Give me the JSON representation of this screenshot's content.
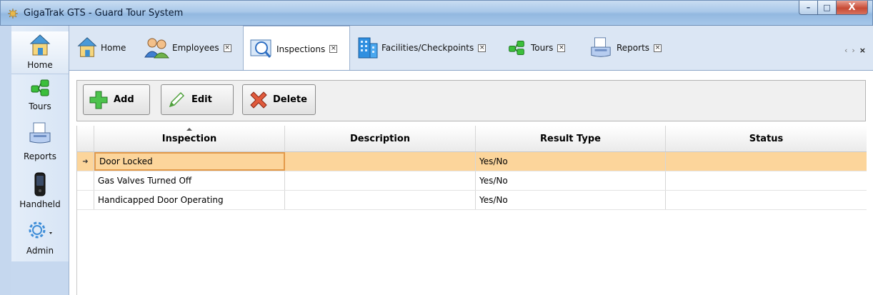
{
  "window": {
    "title": "GigaTrak GTS - Guard Tour System",
    "min_symbol": "–",
    "max_symbol": "□",
    "close_symbol": "X"
  },
  "leftnav": {
    "items": [
      {
        "label": "Home",
        "icon": "home-icon"
      },
      {
        "label": "Tours",
        "icon": "tours-icon"
      },
      {
        "label": "Reports",
        "icon": "reports-icon"
      },
      {
        "label": "Handheld",
        "icon": "handheld-icon"
      },
      {
        "label": "Admin",
        "icon": "gear-icon"
      }
    ]
  },
  "tabs": [
    {
      "label": "Home",
      "icon": "home-icon",
      "closable": false
    },
    {
      "label": "Employees",
      "icon": "employees-icon",
      "closable": true
    },
    {
      "label": "Inspections",
      "icon": "inspections-icon",
      "closable": true,
      "active": true
    },
    {
      "label": "Facilities/Checkpoints",
      "icon": "building-icon",
      "closable": true
    },
    {
      "label": "Tours",
      "icon": "tours-icon",
      "closable": true
    },
    {
      "label": "Reports",
      "icon": "reports-icon",
      "closable": true
    }
  ],
  "tab_close_symbol": "×",
  "tab_nav": {
    "prev": "‹",
    "next": "›",
    "close": "×"
  },
  "toolbar": {
    "add_label": "Add",
    "edit_label": "Edit",
    "delete_label": "Delete"
  },
  "grid": {
    "columns": [
      "Inspection",
      "Description",
      "Result Type",
      "Status"
    ],
    "sorted_column": "Inspection",
    "row_indicator": "➜",
    "rows": [
      {
        "inspection": "Door Locked",
        "description": "",
        "result_type": "Yes/No",
        "status": "",
        "selected": true
      },
      {
        "inspection": "Gas Valves Turned Off",
        "description": "",
        "result_type": "Yes/No",
        "status": ""
      },
      {
        "inspection": "Handicapped Door Operating",
        "description": "",
        "result_type": "Yes/No",
        "status": ""
      }
    ]
  },
  "colors": {
    "selected_row": "#fcd59b",
    "selected_cell_border": "#e39a4a",
    "titlebar": "#a9c8e9"
  }
}
